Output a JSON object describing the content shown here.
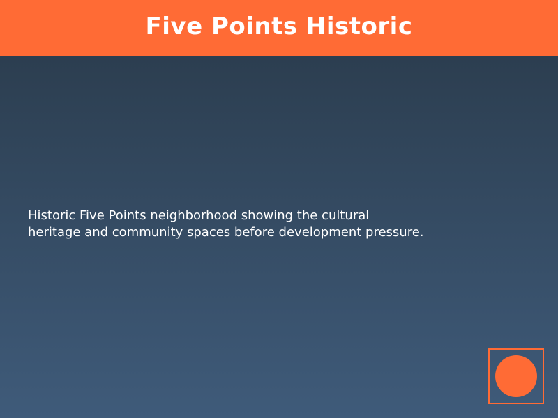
{
  "header": {
    "title": "Five Points Historic"
  },
  "main": {
    "caption": "Historic Five Points neighborhood showing the cultural\nheritage and community spaces before development pressure."
  },
  "colors": {
    "accent": "#ff6b35",
    "background_top": "#2c3e50",
    "background_bottom": "#3f5b7a",
    "text": "#ffffff"
  },
  "icons": {
    "corner_mark": "circle-in-square-icon"
  }
}
